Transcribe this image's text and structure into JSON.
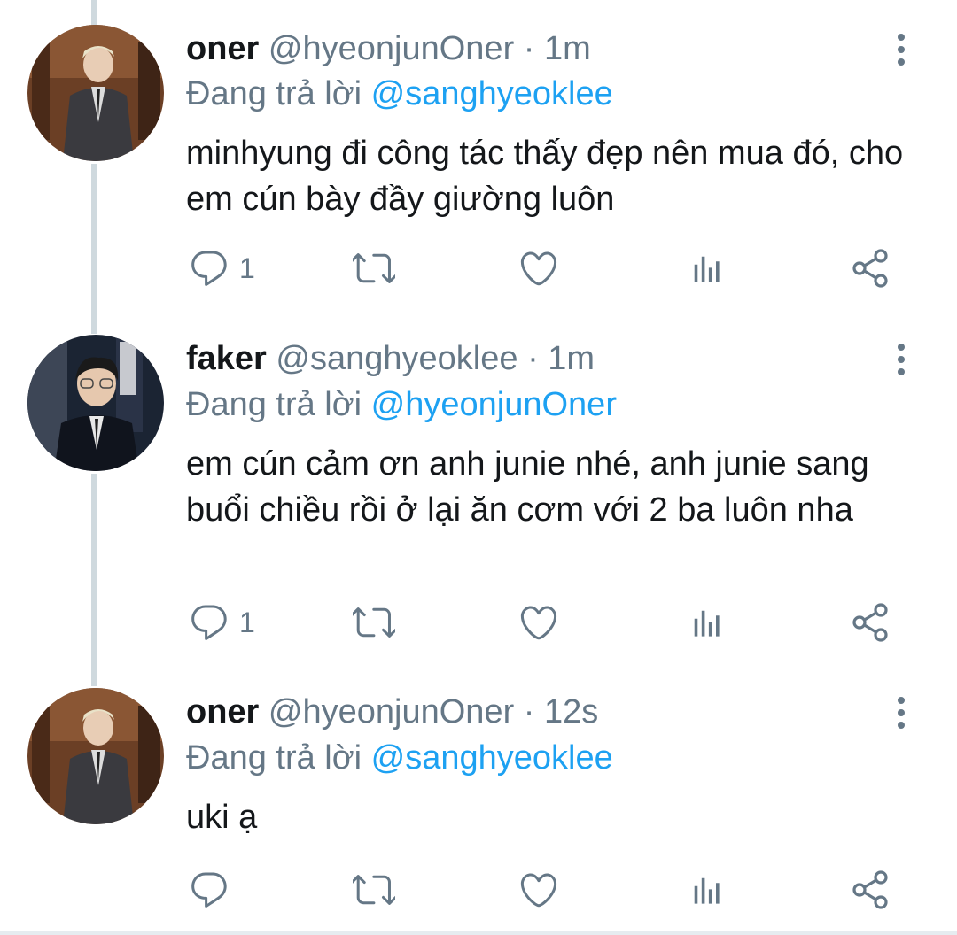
{
  "tweets": [
    {
      "name": "oner",
      "handle": "@hyeonjunOner",
      "separator": "·",
      "time": "1m",
      "replying_prefix": "Đang trả lời",
      "replying_to": "@sanghyeoklee",
      "text": "minhyung đi công tác thấy đẹp nên mua đó, cho em cún bày đầy giường luôn",
      "reply_count": "1",
      "avatar": "avatar-oner"
    },
    {
      "name": "faker",
      "handle": "@sanghyeoklee",
      "separator": "·",
      "time": "1m",
      "replying_prefix": "Đang trả lời",
      "replying_to": "@hyeonjunOner",
      "text": "em cún cảm ơn anh junie nhé, anh junie sang buổi chiều rồi ở lại ăn cơm với 2 ba luôn nha",
      "reply_count": "1",
      "avatar": "avatar-faker"
    },
    {
      "name": "oner",
      "handle": "@hyeonjunOner",
      "separator": "·",
      "time": "12s",
      "replying_prefix": "Đang trả lời",
      "replying_to": "@sanghyeoklee",
      "text": "uki ạ",
      "reply_count": "",
      "avatar": "avatar-oner"
    }
  ],
  "icons": {
    "reply": "reply-icon",
    "retweet": "retweet-icon",
    "like": "heart-icon",
    "analytics": "analytics-icon",
    "share": "share-icon",
    "more": "more-options-icon"
  },
  "colors": {
    "link": "#1da1f2",
    "secondary_text": "#657786",
    "thread_line": "#cfd9de"
  }
}
